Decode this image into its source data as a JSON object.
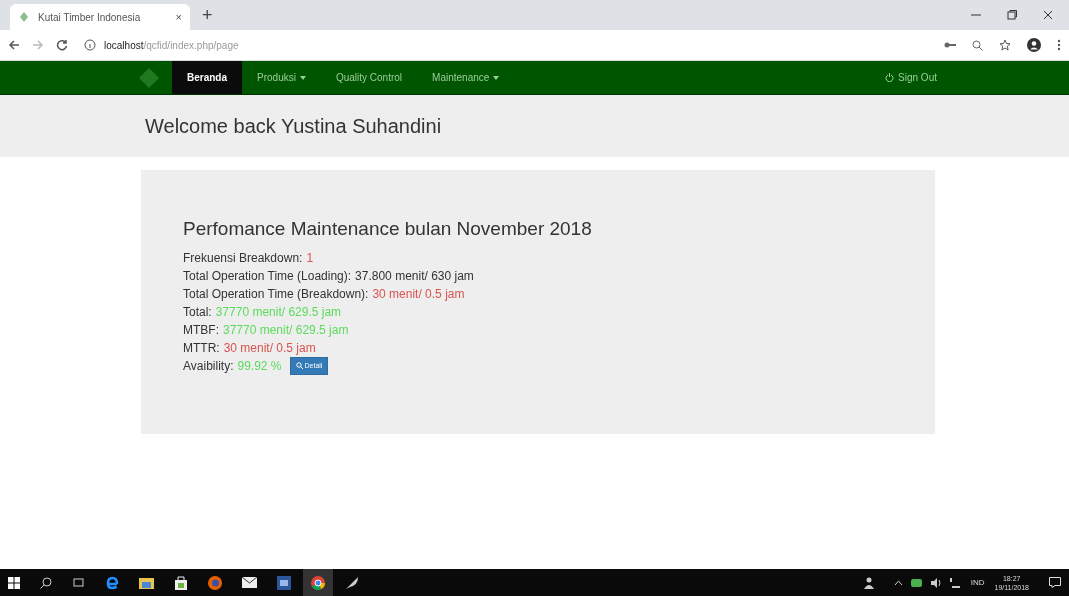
{
  "browser": {
    "tab_title": "Kutai Timber Indonesia",
    "tab_close": "×",
    "new_tab": "+",
    "url_host": "localhost",
    "url_path": "/qcfid/index.php/page"
  },
  "navbar": {
    "items": [
      {
        "label": "Beranda",
        "selected": true,
        "dropdown": false
      },
      {
        "label": "Produksi",
        "selected": false,
        "dropdown": true
      },
      {
        "label": "Quality Control",
        "selected": false,
        "dropdown": false
      },
      {
        "label": "Maintenance",
        "selected": false,
        "dropdown": true
      }
    ],
    "sign_out": "Sign Out"
  },
  "welcome": "Welcome back Yustina Suhandini",
  "card": {
    "title": "Perfomance Maintenance bulan November 2018",
    "lines": [
      {
        "label": "Frekuensi Breakdown:",
        "value": "1",
        "color": "#d9534f"
      },
      {
        "label": "Total Operation Time (Loading):",
        "value": "37.800 menit/ 630 jam",
        "color": "#333333"
      },
      {
        "label": "Total Operation Time (Breakdown):",
        "value": "30 menit/ 0.5 jam",
        "color": "#d9534f"
      },
      {
        "label": "Total:",
        "value": "37770 menit/ 629.5 jam",
        "color": "#5cdb5c"
      },
      {
        "label": "MTBF:",
        "value": "37770 menit/ 629.5 jam",
        "color": "#5cdb5c"
      },
      {
        "label": "MTTR:",
        "value": "30 menit/ 0.5 jam",
        "color": "#d9534f"
      },
      {
        "label": "Avaibility:",
        "value": "99.92 %",
        "color": "#5cdb5c",
        "button": "Detail"
      }
    ]
  },
  "taskbar": {
    "tray_lang": "IND",
    "time": "18:27",
    "date": "19/11/2018"
  }
}
